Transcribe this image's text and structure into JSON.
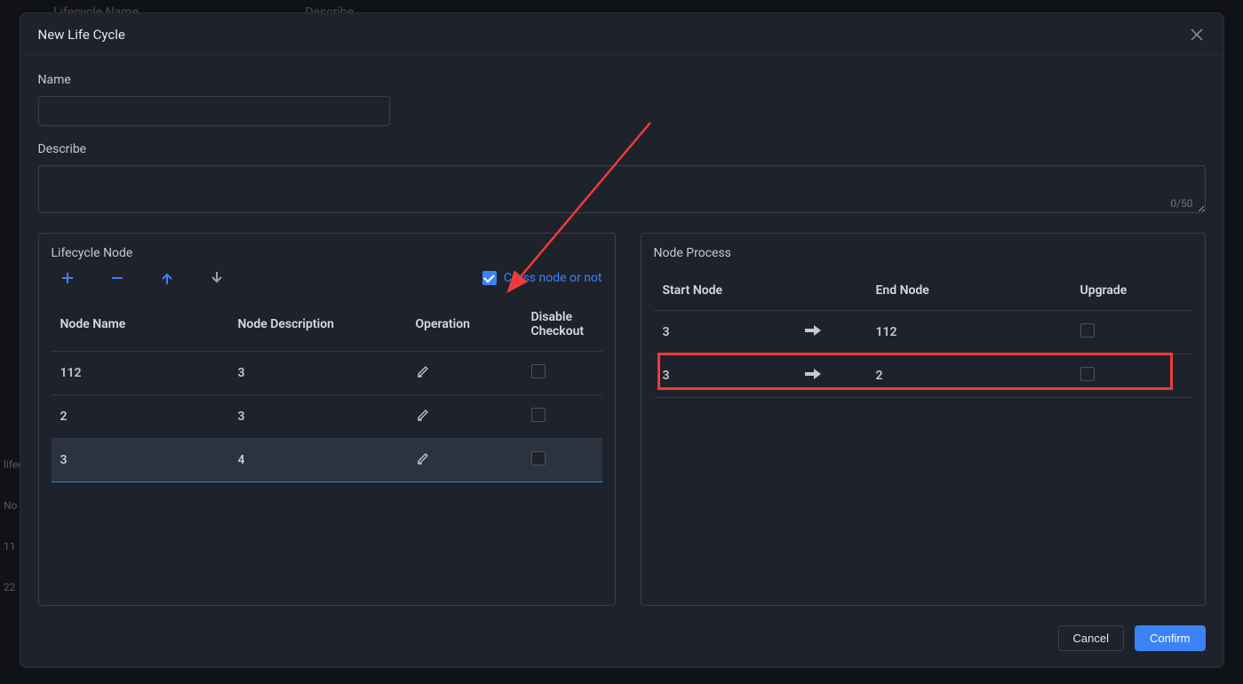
{
  "background": {
    "col1": "Lifecycle Name",
    "col2": "Describe",
    "sideLabel": "lifecy",
    "sideSub": "No",
    "row1": "11",
    "row2": "22"
  },
  "modal": {
    "title": "New Life Cycle",
    "name_label": "Name",
    "name_value": "",
    "describe_label": "Describe",
    "describe_value": "",
    "char_count": "0/50"
  },
  "lifecycleNode": {
    "title": "Lifecycle Node",
    "cross_node_label": "Cross node or not",
    "cross_node_checked": true,
    "columns": {
      "c1": "Node Name",
      "c2": "Node Description",
      "c3": "Operation",
      "c4": "Disable Checkout"
    },
    "rows": [
      {
        "name": "112",
        "desc": "3",
        "disable": false,
        "selected": false
      },
      {
        "name": "2",
        "desc": "3",
        "disable": false,
        "selected": false
      },
      {
        "name": "3",
        "desc": "4",
        "disable": false,
        "selected": true
      }
    ]
  },
  "nodeProcess": {
    "title": "Node Process",
    "columns": {
      "c1": "Start Node",
      "c2": "End Node",
      "c3": "Upgrade"
    },
    "rows": [
      {
        "start": "3",
        "end": "112",
        "upgrade": false,
        "highlight": false
      },
      {
        "start": "3",
        "end": "2",
        "upgrade": false,
        "highlight": true
      }
    ]
  },
  "footer": {
    "cancel": "Cancel",
    "confirm": "Confirm"
  }
}
